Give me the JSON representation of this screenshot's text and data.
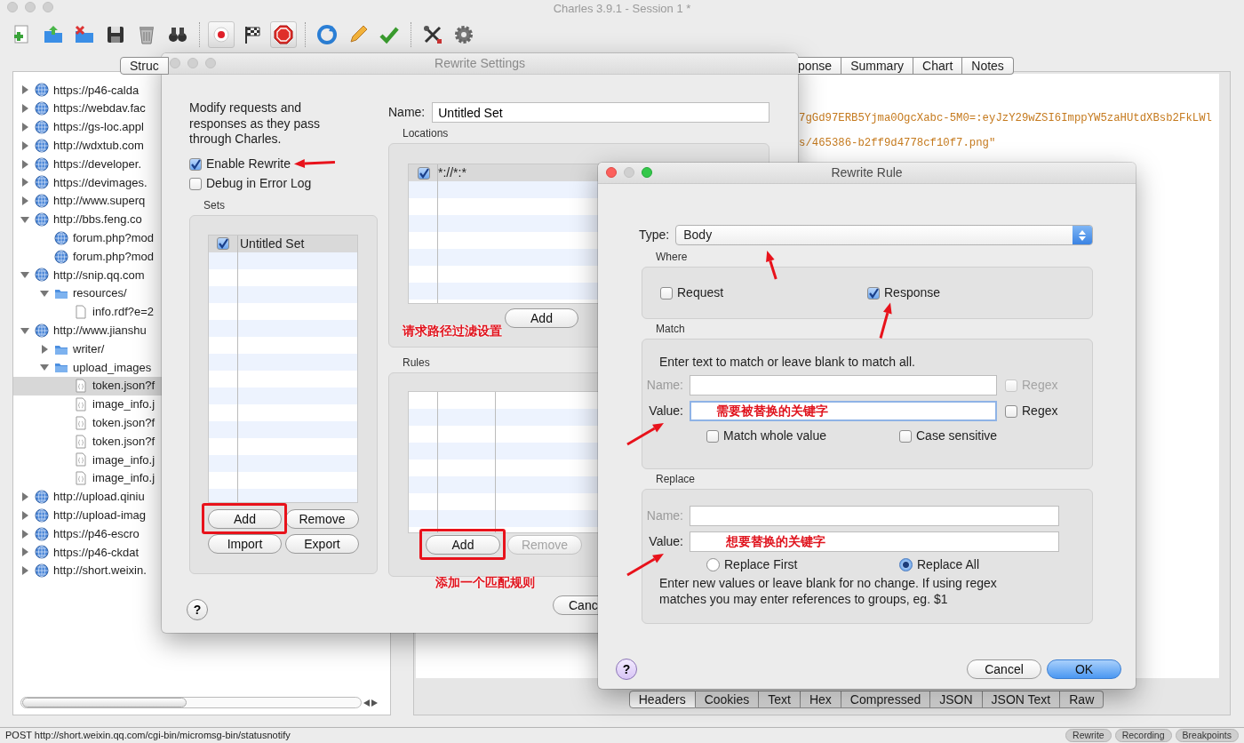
{
  "main_window": {
    "title": "Charles 3.9.1 - Session 1 *",
    "toolbar": [
      {
        "pressed": false
      },
      {
        "pressed": false
      },
      {
        "pressed": false
      },
      {
        "pressed": false
      },
      {
        "pressed": false
      },
      {
        "pressed": false
      },
      {
        "pressed": true
      },
      {
        "pressed": false
      },
      {
        "pressed": true
      },
      {
        "pressed": false
      },
      {
        "pressed": false
      },
      {
        "pressed": false
      },
      {
        "pressed": false
      },
      {
        "pressed": false
      }
    ],
    "left_tab": "Struc",
    "right_tabs": [
      "ponse",
      "Summary",
      "Chart",
      "Notes"
    ],
    "tree": [
      {
        "label": "https://p46-calda",
        "kind": "globe",
        "expanded": false,
        "selected": false
      },
      {
        "label": "https://webdav.fac",
        "kind": "globe",
        "expanded": false,
        "selected": false
      },
      {
        "label": "https://gs-loc.appl",
        "kind": "globe",
        "expanded": false,
        "selected": false
      },
      {
        "label": "http://wdxtub.com",
        "kind": "globe",
        "expanded": false,
        "selected": false
      },
      {
        "label": "https://developer.",
        "kind": "globe",
        "expanded": false,
        "selected": false
      },
      {
        "label": "https://devimages.",
        "kind": "globe",
        "expanded": false,
        "selected": false
      },
      {
        "label": "http://www.superq",
        "kind": "globe",
        "expanded": false,
        "selected": false
      },
      {
        "label": "http://bbs.feng.co",
        "kind": "globe",
        "expanded": true,
        "selected": false,
        "children": [
          {
            "label": "forum.php?mod",
            "kind": "globe",
            "selected": false
          },
          {
            "label": "forum.php?mod",
            "kind": "globe",
            "selected": false
          }
        ]
      },
      {
        "label": "http://snip.qq.com",
        "kind": "globe",
        "expanded": true,
        "selected": false,
        "children": [
          {
            "label": "resources/",
            "kind": "folder",
            "expanded": true,
            "selected": false,
            "children": [
              {
                "label": "info.rdf?e=2",
                "kind": "file",
                "selected": false
              }
            ]
          }
        ]
      },
      {
        "label": "http://www.jianshu",
        "kind": "globe",
        "expanded": true,
        "selected": false,
        "children": [
          {
            "label": "writer/",
            "kind": "folder",
            "expanded": false,
            "selected": false
          },
          {
            "label": "upload_images",
            "kind": "folder",
            "expanded": true,
            "selected": false,
            "children": [
              {
                "label": "token.json?f",
                "kind": "json",
                "selected": true
              },
              {
                "label": "image_info.j",
                "kind": "json",
                "selected": false
              },
              {
                "label": "token.json?f",
                "kind": "json",
                "selected": false
              },
              {
                "label": "token.json?f",
                "kind": "json",
                "selected": false
              },
              {
                "label": "image_info.j",
                "kind": "json",
                "selected": false
              },
              {
                "label": "image_info.j",
                "kind": "json",
                "selected": false
              }
            ]
          }
        ]
      },
      {
        "label": "http://upload.qiniu",
        "kind": "globe",
        "expanded": false,
        "selected": false
      },
      {
        "label": "http://upload-imag",
        "kind": "globe",
        "expanded": false,
        "selected": false
      },
      {
        "label": "https://p46-escro",
        "kind": "globe",
        "expanded": false,
        "selected": false
      },
      {
        "label": "https://p46-ckdat",
        "kind": "globe",
        "expanded": false,
        "selected": false
      },
      {
        "label": "http://short.weixin.",
        "kind": "globe",
        "expanded": false,
        "selected": false
      }
    ],
    "content_lines": [
      "7gGd97ERB5Yjma0OgcXabc-5M0=:eyJzY29wZSI6ImppYW5zaHUtdXBsb2FkLWl",
      "s/465386-b2ff9d4778cf10f7.png\""
    ],
    "bottom_tabs": [
      {
        "label": "Headers",
        "selected": true
      },
      {
        "label": "Cookies",
        "selected": false
      },
      {
        "label": "Text",
        "selected": false
      },
      {
        "label": "Hex",
        "selected": false
      },
      {
        "label": "Compressed",
        "selected": false
      },
      {
        "label": "JSON",
        "selected": false
      },
      {
        "label": "JSON Text",
        "selected": false
      },
      {
        "label": "Raw",
        "selected": false
      }
    ],
    "status_bar": {
      "text": "POST http://short.weixin.qq.com/cgi-bin/micromsg-bin/statusnotify",
      "buttons": [
        "Rewrite",
        "Recording",
        "Breakpoints"
      ]
    }
  },
  "rewrite_settings": {
    "title": "Rewrite Settings",
    "description": "Modify requests and responses as they pass through Charles.",
    "options": [
      {
        "label": "Enable Rewrite",
        "checked": true
      },
      {
        "label": "Debug in Error Log",
        "checked": false
      }
    ],
    "sets_label": "Sets",
    "sets": [
      {
        "name": "Untitled Set",
        "checked": true,
        "selected": true
      }
    ],
    "set_buttons": [
      "Add",
      "Remove",
      "Import",
      "Export"
    ],
    "name_label": "Name:",
    "name_value": "Untitled Set",
    "locations_label": "Locations",
    "locations": [
      {
        "pattern": "*://*:*",
        "checked": true
      }
    ],
    "location_button": "Add",
    "locations_note": "请求路径过滤设置",
    "rules_label": "Rules",
    "rule_buttons": [
      {
        "label": "Add",
        "disabled": false
      },
      {
        "label": "Remove",
        "disabled": true
      }
    ],
    "rules_note": "添加一个匹配规则",
    "cancel": "Canc",
    "help": "?"
  },
  "rewrite_rule": {
    "title": "Rewrite Rule",
    "type_label": "Type:",
    "type_value": "Body",
    "where_label": "Where",
    "where": [
      {
        "label": "Request",
        "checked": false
      },
      {
        "label": "Response",
        "checked": true
      }
    ],
    "match_label": "Match",
    "match_hint": "Enter text to match or leave blank to match all.",
    "match_fields": [
      {
        "label": "Name:",
        "disabled": true,
        "regex": {
          "label": "Regex",
          "checked": false,
          "disabled": true
        }
      },
      {
        "label": "Value:",
        "value": "需要被替换的关键字",
        "disabled": false,
        "regex": {
          "label": "Regex",
          "checked": false,
          "disabled": false
        }
      }
    ],
    "match_options": [
      {
        "label": "Match whole value",
        "checked": false
      },
      {
        "label": "Case sensitive",
        "checked": false
      }
    ],
    "replace_label": "Replace",
    "replace_fields": [
      {
        "label": "Name:",
        "disabled": true
      },
      {
        "label": "Value:",
        "value": "想要替换的关键字",
        "disabled": false
      }
    ],
    "replace_modes": [
      {
        "label": "Replace First",
        "selected": false
      },
      {
        "label": "Replace All",
        "selected": true
      }
    ],
    "replace_hint": "Enter new values or leave blank for no change. If using regex matches you may enter references to groups, eg. $1",
    "help": "?",
    "buttons": [
      {
        "label": "Cancel",
        "default": false
      },
      {
        "label": "OK",
        "default": true
      }
    ]
  }
}
